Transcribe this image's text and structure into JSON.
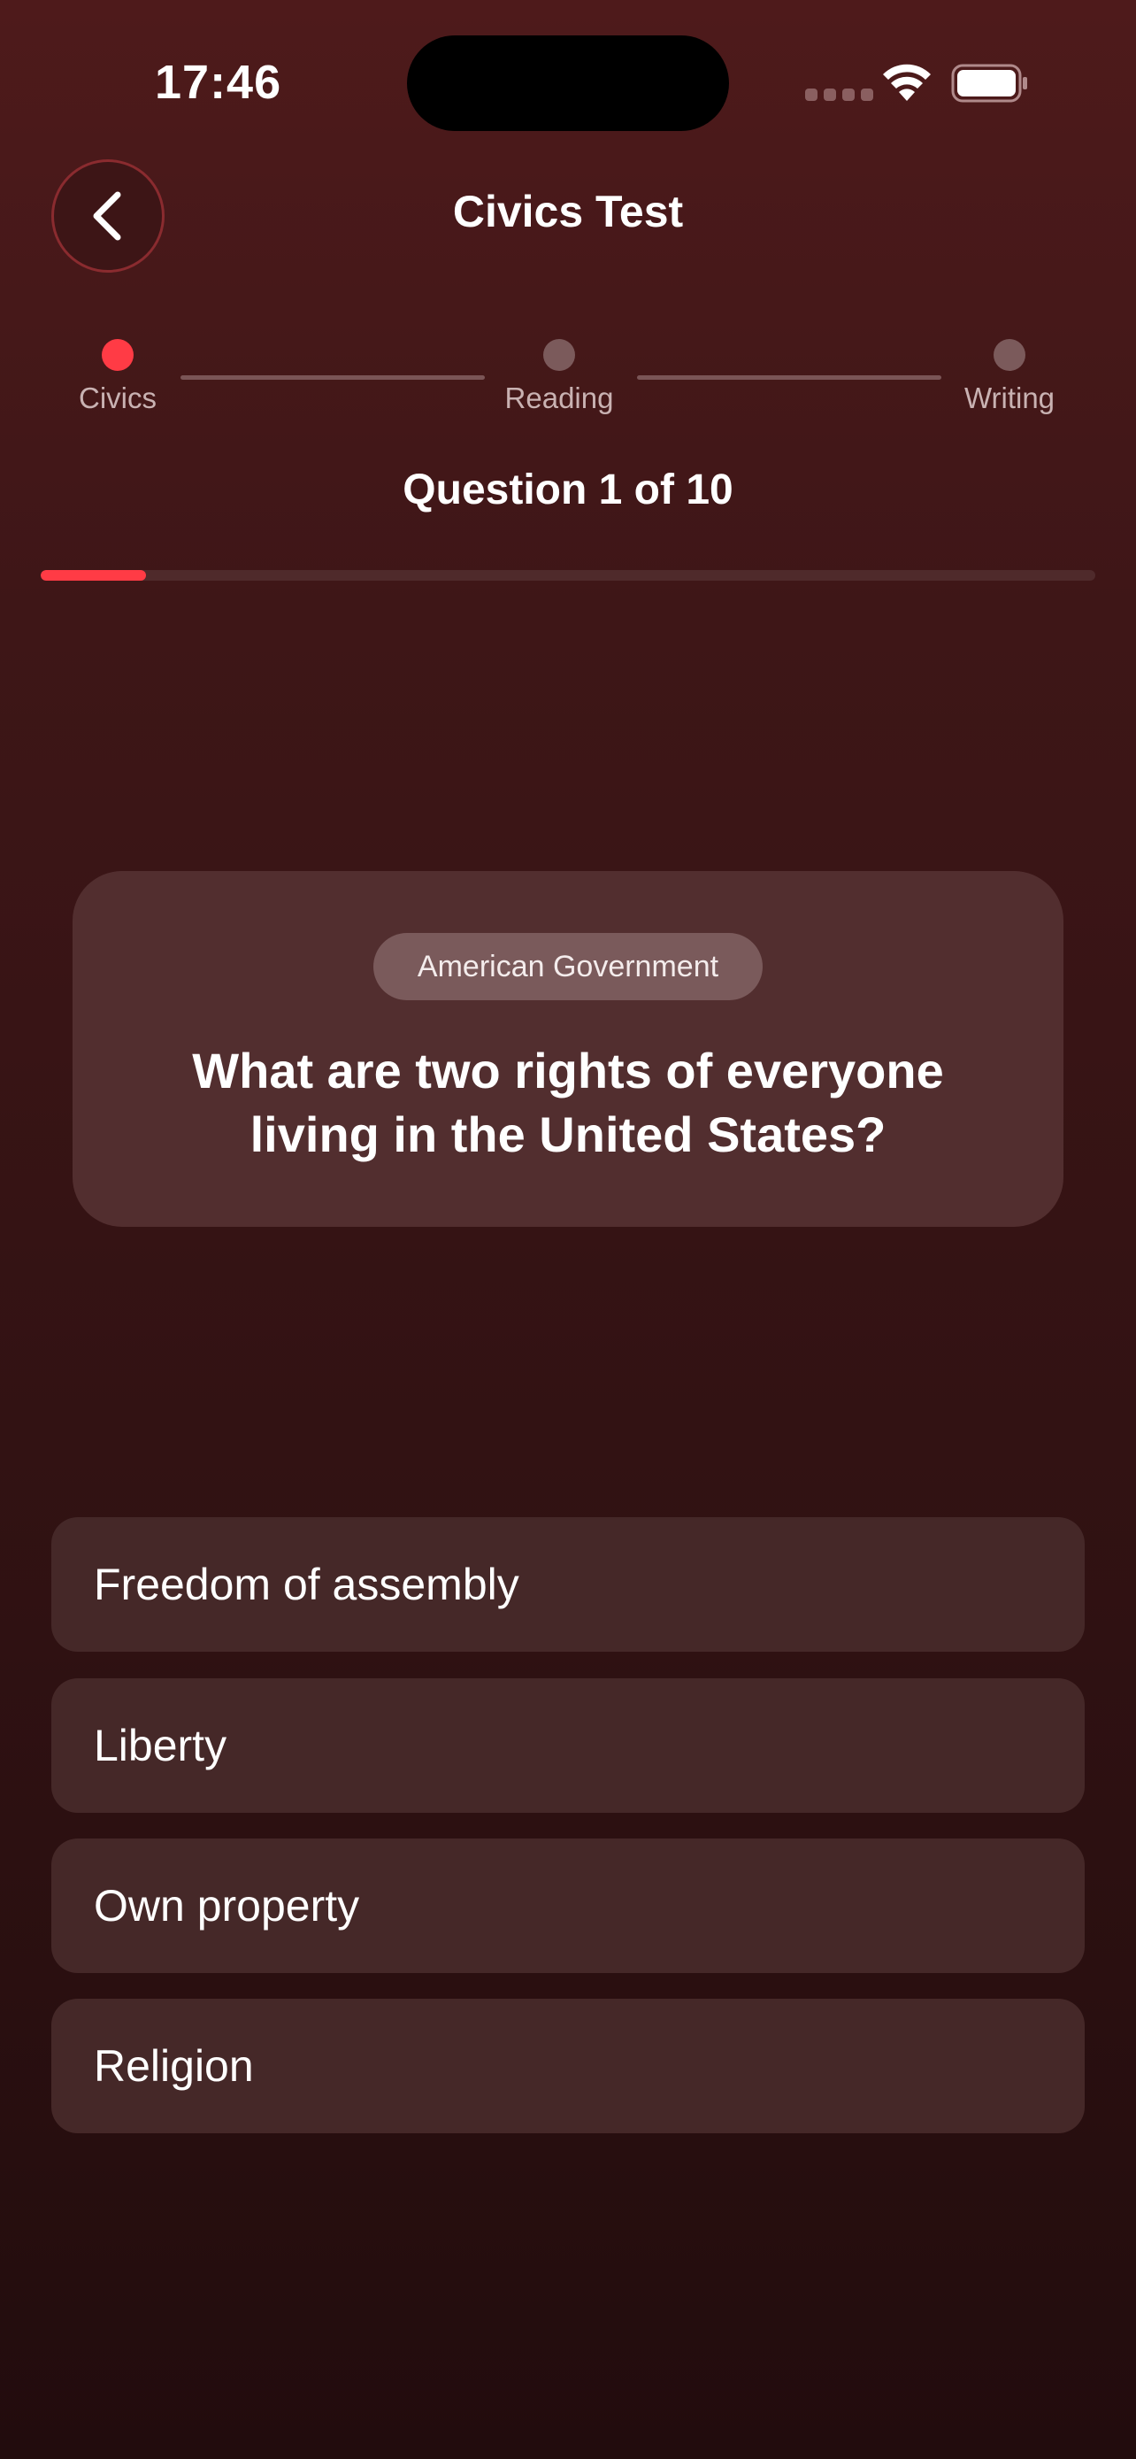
{
  "status_bar": {
    "time": "17:46",
    "icons": [
      "signal-dots-icon",
      "wifi-icon",
      "battery-icon"
    ]
  },
  "header": {
    "title": "Civics Test",
    "back_icon": "chevron-left-icon"
  },
  "stepper": {
    "steps": [
      {
        "label": "Civics",
        "active": true
      },
      {
        "label": "Reading",
        "active": false
      },
      {
        "label": "Writing",
        "active": false
      }
    ]
  },
  "quiz": {
    "counter": "Question 1 of 10",
    "progress_fraction": 0.1
  },
  "question": {
    "category": "American Government",
    "text": "What are two rights of everyone living in the United States?"
  },
  "answers": [
    "Freedom of assembly",
    "Liberty",
    "Own property",
    "Religion"
  ],
  "colors": {
    "accent": "#ff3b45",
    "background_top": "#4e1a1b",
    "background_bottom": "#220c0d",
    "card": "#522e2f",
    "answer": "#452828"
  }
}
